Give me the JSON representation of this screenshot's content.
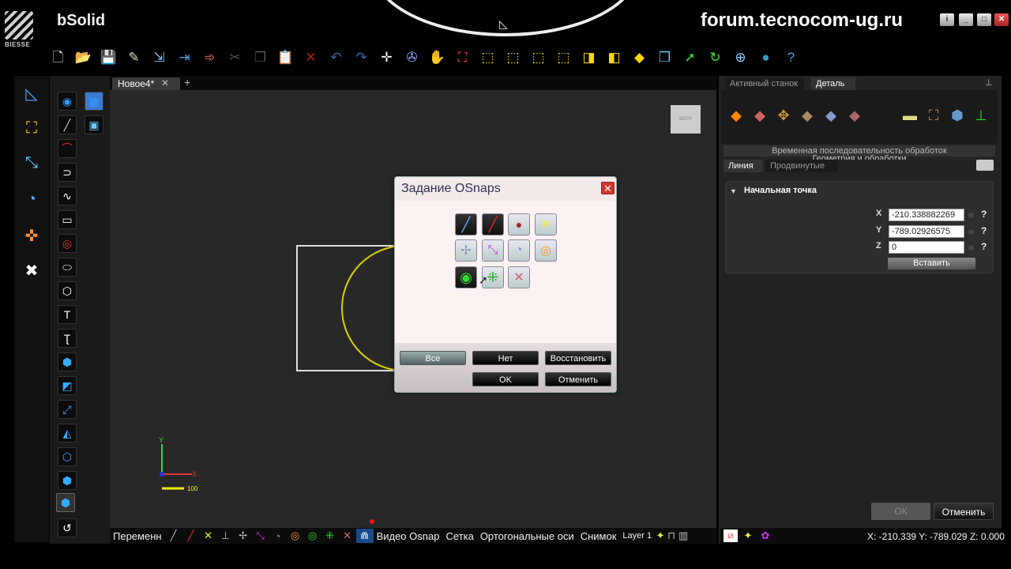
{
  "app": {
    "brand": "BIESSE",
    "name": "bSolid",
    "watermark": "forum.tecnocom-ug.ru"
  },
  "window_buttons": [
    "i",
    "_",
    "□",
    "✕"
  ],
  "document": {
    "tab": "Новое4*",
    "close": "✕",
    "add": "+",
    "viewcube_label": "ВЕРХ"
  },
  "axes": {
    "y": "Y",
    "x": "X",
    "scale": "100"
  },
  "statusbar": {
    "first": "Переменн",
    "video_osnap": "Видео Osnap",
    "grid": "Сетка",
    "ortho": "Ортогональные оси",
    "snapshot": "Снимок",
    "layer": "Layer 1"
  },
  "right_panel": {
    "tab_machine": "Активный станок",
    "tab_detail": "Деталь",
    "sequence": "Временная последовательность обработок",
    "geometry": "Геометрия и обработки",
    "tab_line": "Линия",
    "tab_advanced": "Продвинутые",
    "section_title": "Начальная точка",
    "x_label": "X",
    "y_label": "Y",
    "z_label": "Z",
    "x_value": "-210.338882269",
    "y_value": "-789.02926575",
    "z_value": "0",
    "help": "?",
    "insert": "Вставить",
    "ok": "ОК",
    "cancel": "Отменить",
    "coords": "X: -210.339  Y: -789.029  Z: 0.000"
  },
  "dialog": {
    "title": "Задание OSnaps",
    "close": "✕",
    "btn_all": "Все",
    "btn_none": "Нет",
    "btn_restore": "Восстановить",
    "btn_ok": "OK",
    "btn_cancel": "Отменить"
  },
  "colors": {
    "accent_yellow": "#d8d000",
    "close_red": "#d2342a",
    "canvas": "#282828"
  }
}
